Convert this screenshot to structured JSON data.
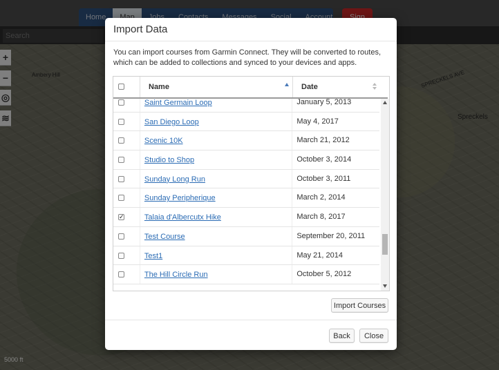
{
  "background": {
    "nav_tabs": [
      {
        "label": "Home"
      },
      {
        "label": "Map"
      },
      {
        "label": "Jobs"
      },
      {
        "label": "Contacts"
      },
      {
        "label": "Messages"
      },
      {
        "label": "Social"
      },
      {
        "label": "Account"
      }
    ],
    "nav_red_label": "Sign",
    "search_placeholder": "Search",
    "map_labels": [
      "Spreckels",
      "SPRECKELS AVE",
      "Ambery Hill"
    ],
    "scale_label": "5000 ft"
  },
  "modal": {
    "title": "Import Data",
    "description": "You can import courses from Garmin Connect. They will be converted to routes, which can be added to collections and synced to your devices and apps.",
    "table": {
      "headers": {
        "name": "Name",
        "date": "Date"
      },
      "rows": [
        {
          "name": "Saint Germain Loop",
          "date": "January 5, 2013",
          "checked": false
        },
        {
          "name": "San Diego Loop",
          "date": "May 4, 2017",
          "checked": false
        },
        {
          "name": "Scenic 10K",
          "date": "March 21, 2012",
          "checked": false
        },
        {
          "name": "Studio to Shop",
          "date": "October 3, 2014",
          "checked": false
        },
        {
          "name": "Sunday Long Run",
          "date": "October 3, 2011",
          "checked": false
        },
        {
          "name": "Sunday Peripherique",
          "date": "March 2, 2014",
          "checked": false
        },
        {
          "name": "Talaia d'Albercutx Hike",
          "date": "March 8, 2017",
          "checked": true
        },
        {
          "name": "Test Course",
          "date": "September 20, 2011",
          "checked": false
        },
        {
          "name": "Test1",
          "date": "May 21, 2014",
          "checked": false
        },
        {
          "name": "The Hill Circle Run",
          "date": "October 5, 2012",
          "checked": false
        }
      ]
    },
    "import_button": "Import Courses",
    "back_button": "Back",
    "close_button": "Close"
  }
}
